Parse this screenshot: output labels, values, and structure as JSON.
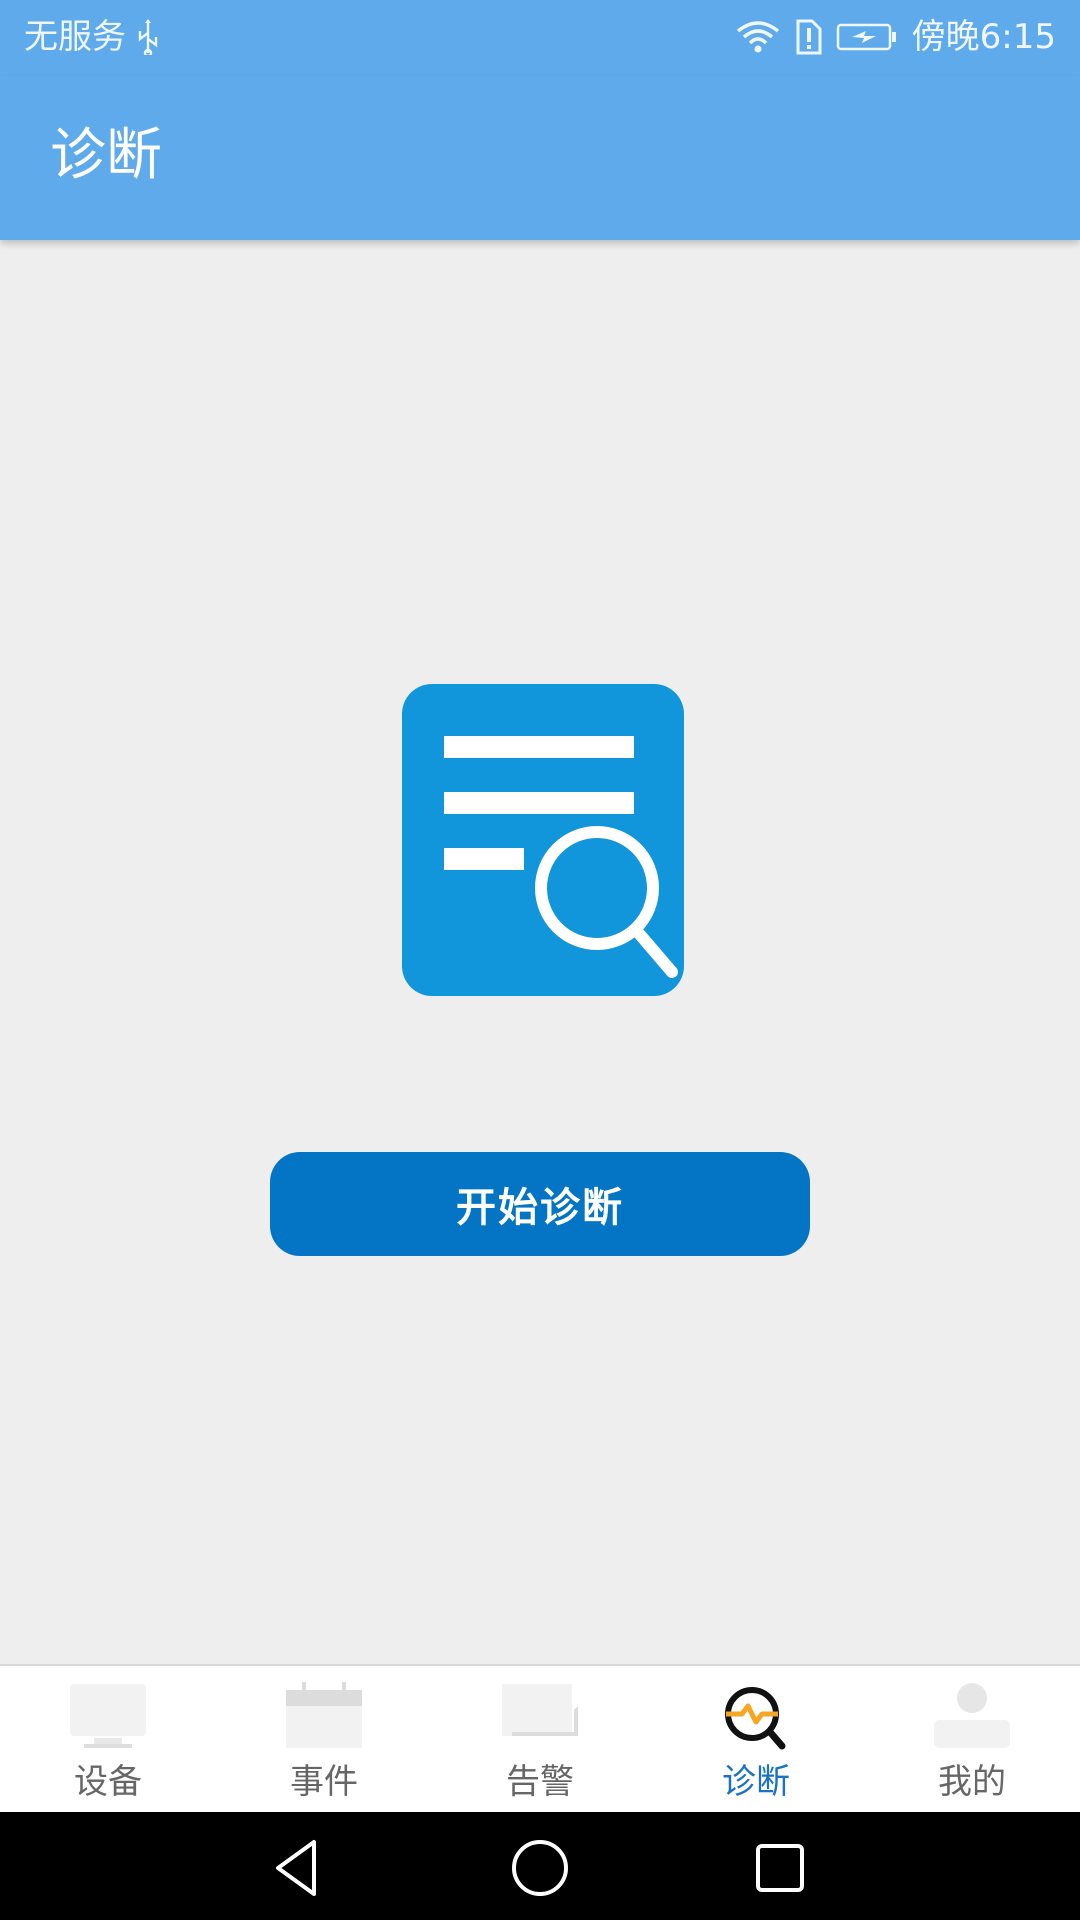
{
  "status_bar": {
    "carrier": "无服务",
    "time": "傍晚6:15"
  },
  "app_bar": {
    "title": "诊断"
  },
  "main": {
    "start_button_label": "开始诊断"
  },
  "bottom_nav": {
    "items": [
      {
        "label": "设备",
        "icon": "monitor-icon"
      },
      {
        "label": "事件",
        "icon": "calendar-icon"
      },
      {
        "label": "告警",
        "icon": "alert-icon"
      },
      {
        "label": "诊断",
        "icon": "diagnose-icon",
        "active": true
      },
      {
        "label": "我的",
        "icon": "profile-icon"
      }
    ]
  },
  "colors": {
    "primary": "#5eaaeb",
    "button": "#0375c4",
    "hero_icon": "#1296db",
    "active_tab": "#1a72c7",
    "accent_orange": "#f5a623"
  }
}
